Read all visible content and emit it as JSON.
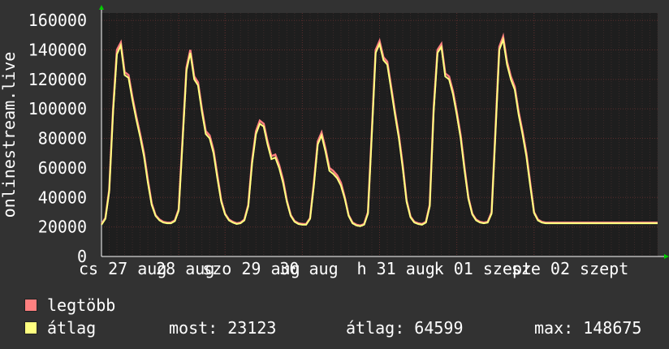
{
  "chart_data": {
    "type": "line",
    "ylabel": "onlinestream.live",
    "ylim": [
      0,
      165000
    ],
    "yticks": [
      0,
      20000,
      40000,
      60000,
      80000,
      100000,
      120000,
      140000,
      160000
    ],
    "xlim": [
      0,
      7.2
    ],
    "xticks": [
      {
        "x": 0,
        "label": "cs 27 aug"
      },
      {
        "x": 1,
        "label": "28 aug"
      },
      {
        "x": 1.6,
        "label": "szo 29 aug"
      },
      {
        "x": 2.6,
        "label": "30 aug"
      },
      {
        "x": 3.6,
        "label": "h 31 aug"
      },
      {
        "x": 4.6,
        "label": "k 01 szept"
      },
      {
        "x": 5.6,
        "label": "sze 02 szept"
      }
    ],
    "grid": true,
    "series": [
      {
        "name": "legtöbb",
        "color": "#ff8080"
      },
      {
        "name": "átlag",
        "color": "#ffff80"
      }
    ],
    "x": [
      0.0,
      0.05,
      0.1,
      0.15,
      0.2,
      0.25,
      0.3,
      0.35,
      0.4,
      0.45,
      0.5,
      0.55,
      0.6,
      0.65,
      0.7,
      0.75,
      0.8,
      0.85,
      0.9,
      0.95,
      1.0,
      1.05,
      1.1,
      1.15,
      1.2,
      1.25,
      1.3,
      1.35,
      1.4,
      1.45,
      1.5,
      1.55,
      1.6,
      1.65,
      1.7,
      1.75,
      1.8,
      1.85,
      1.9,
      1.95,
      2.0,
      2.05,
      2.1,
      2.15,
      2.2,
      2.25,
      2.3,
      2.35,
      2.4,
      2.45,
      2.5,
      2.55,
      2.6,
      2.65,
      2.7,
      2.75,
      2.8,
      2.85,
      2.9,
      2.95,
      3.0,
      3.05,
      3.1,
      3.15,
      3.2,
      3.25,
      3.3,
      3.35,
      3.4,
      3.45,
      3.5,
      3.55,
      3.6,
      3.65,
      3.7,
      3.75,
      3.8,
      3.85,
      3.9,
      3.95,
      4.0,
      4.05,
      4.1,
      4.15,
      4.2,
      4.25,
      4.3,
      4.35,
      4.4,
      4.45,
      4.5,
      4.55,
      4.6,
      4.65,
      4.7,
      4.75,
      4.8,
      4.85,
      4.9,
      4.95,
      5.0,
      5.05,
      5.1,
      5.15,
      5.2,
      5.25,
      5.3,
      5.35,
      5.4,
      5.45,
      5.5,
      5.55,
      5.6,
      5.65,
      5.7,
      5.75,
      5.8,
      5.85,
      5.9,
      5.95,
      6.0,
      6.05,
      6.1,
      6.15,
      6.2,
      6.25,
      6.3,
      6.35,
      6.4,
      6.45,
      6.5,
      6.55,
      6.6,
      6.65,
      6.7,
      6.75,
      6.8,
      6.85,
      6.9,
      6.95,
      7.0,
      7.05,
      7.1,
      7.15,
      7.2
    ],
    "max": [
      22000,
      26000,
      45000,
      100000,
      140000,
      145000,
      125000,
      123000,
      108000,
      95000,
      83000,
      70000,
      52000,
      36000,
      28000,
      25000,
      23500,
      23000,
      23000,
      24500,
      32000,
      80000,
      128000,
      140000,
      122000,
      118000,
      100000,
      85000,
      82000,
      72000,
      55000,
      38000,
      29000,
      25000,
      23500,
      22500,
      23000,
      25000,
      35000,
      65000,
      85000,
      92000,
      90000,
      78000,
      68000,
      69000,
      62000,
      52000,
      38000,
      28000,
      24000,
      22500,
      22000,
      22000,
      26000,
      50000,
      78000,
      84000,
      73000,
      60000,
      58000,
      55000,
      50000,
      40000,
      28000,
      23000,
      21500,
      21000,
      22000,
      30000,
      85000,
      140000,
      146000,
      135000,
      132000,
      115000,
      98000,
      82000,
      62000,
      38000,
      27000,
      23500,
      22500,
      22000,
      23500,
      35000,
      100000,
      140000,
      144000,
      124000,
      122000,
      112000,
      98000,
      82000,
      60000,
      40000,
      29000,
      25000,
      23500,
      23000,
      23500,
      30000,
      85000,
      142000,
      149000,
      132000,
      122000,
      115000,
      98000,
      85000,
      70000,
      50000,
      30000,
      25000,
      23500,
      23000,
      23000,
      23000,
      23000,
      23000,
      23000,
      23000,
      23000,
      23000,
      23000,
      23000,
      23000,
      23000,
      23000,
      23000,
      23000,
      23000,
      23000,
      23000,
      23000,
      23000,
      23000,
      23000,
      23000,
      23000,
      23000,
      23000,
      23000,
      23000,
      23000
    ],
    "values": [
      21500,
      25500,
      44000,
      98000,
      137000,
      143000,
      123000,
      121000,
      106000,
      93000,
      81000,
      68000,
      50000,
      35000,
      27500,
      24500,
      23000,
      22500,
      22500,
      24000,
      31000,
      78000,
      126000,
      138000,
      120000,
      116000,
      98000,
      83000,
      80000,
      70000,
      53000,
      37000,
      28500,
      24500,
      23000,
      22000,
      22500,
      24500,
      34000,
      63000,
      83000,
      90000,
      88000,
      76000,
      66000,
      67000,
      60000,
      50000,
      37000,
      27500,
      23500,
      22000,
      21500,
      21500,
      25500,
      48000,
      76000,
      82000,
      71000,
      58000,
      56000,
      53000,
      48000,
      39000,
      27500,
      22500,
      21000,
      20500,
      21500,
      29000,
      83000,
      138000,
      144000,
      133000,
      130000,
      113000,
      96000,
      80000,
      60000,
      37000,
      26500,
      23000,
      22000,
      21500,
      23000,
      34000,
      98000,
      138000,
      142000,
      122000,
      120000,
      110000,
      96000,
      80000,
      58000,
      39000,
      28500,
      24500,
      23000,
      22500,
      23000,
      29000,
      83000,
      140000,
      147000,
      130000,
      120000,
      113000,
      96000,
      83000,
      68000,
      48000,
      29500,
      24500,
      23000,
      22500,
      22500,
      22500,
      22500,
      22500,
      22500,
      22500,
      22500,
      22500,
      22500,
      22500,
      22500,
      22500,
      22500,
      22500,
      22500,
      22500,
      22500,
      22500,
      22500,
      22500,
      22500,
      22500,
      22500,
      22500,
      22500,
      22500,
      22500,
      22500,
      22500
    ]
  },
  "legend": {
    "max_label": "legtöbb",
    "avg_label": "átlag",
    "most": "most: 23123",
    "atlag": "átlag: 64599",
    "maxv": "max: 148675"
  }
}
